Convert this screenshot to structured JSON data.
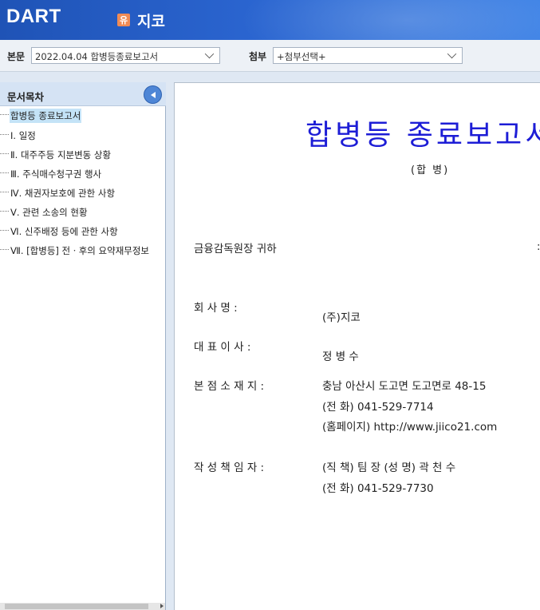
{
  "header": {
    "logo": "DART",
    "company_badge": "유",
    "company_name": "지코"
  },
  "toolbar": {
    "main_label": "본문",
    "main_select_value": "2022.04.04  합병등종료보고서",
    "attach_label": "첨부",
    "attach_select_value": "+첨부선택+"
  },
  "toc": {
    "title": "문서목차",
    "items": [
      {
        "label": "합병등 종료보고서"
      },
      {
        "label": "Ⅰ. 일정"
      },
      {
        "label": "Ⅱ. 대주주등 지분변동 상황"
      },
      {
        "label": "Ⅲ. 주식매수청구권 행사"
      },
      {
        "label": "Ⅳ. 채권자보호에 관한 사항"
      },
      {
        "label": "Ⅴ. 관련 소송의 현황"
      },
      {
        "label": "Ⅵ. 신주배정 등에 관한 사항"
      },
      {
        "label": "Ⅶ. [합병등] 전ㆍ후의 요약재무정보"
      }
    ]
  },
  "document": {
    "title": "합병등 종료보고서",
    "subtitle": "(합 병)",
    "addressee": "금융감독원장 귀하",
    "right_mark": ":",
    "fields": {
      "company_label": "회       사       명  :",
      "company_value": "(주)지코",
      "ceo_label": "대    표      이    사  :",
      "ceo_value": "정 병 수",
      "address_label": "본  점  소  재  지  :",
      "address_value": "충남 아산시 도고면 도고면로 48-15",
      "phone_value": "(전  화) 041-529-7714",
      "homepage_value": "(홈페이지) http://www.jiico21.com",
      "writer_label": "작  성  책  임  자  :",
      "writer_title_value": "(직  책) 팀 장              (성  명) 곽 천 수",
      "writer_phone_value": "(전  화) 041-529-7730"
    }
  }
}
